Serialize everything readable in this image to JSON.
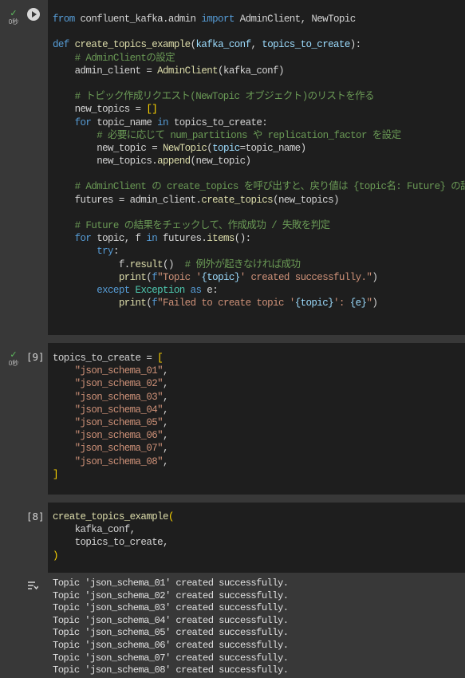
{
  "cells": [
    {
      "status_check": "✓",
      "status_time": "0秒",
      "exec_count": "",
      "lines": [
        "from confluent_kafka.admin import AdminClient, NewTopic",
        "",
        "def create_topics_example(kafka_conf, topics_to_create):",
        "    # AdminClientの設定",
        "    admin_client = AdminClient(kafka_conf)",
        "",
        "    # トピック作成リクエスト(NewTopic オブジェクト)のリストを作る",
        "    new_topics = []",
        "    for topic_name in topics_to_create:",
        "        # 必要に応じて num_partitions や replication_factor を設定",
        "        new_topic = NewTopic(topic=topic_name)",
        "        new_topics.append(new_topic)",
        "",
        "    # AdminClient の create_topics を呼び出すと、戻り値は {topic名: Future} の辞書",
        "    futures = admin_client.create_topics(new_topics)",
        "",
        "    # Future の結果をチェックして、作成成功 / 失敗を判定",
        "    for topic, f in futures.items():",
        "        try:",
        "            f.result()  # 例外が起きなければ成功",
        "            print(f\"Topic '{topic}' created successfully.\")",
        "        except Exception as e:",
        "            print(f\"Failed to create topic '{topic}': {e}\")"
      ]
    },
    {
      "status_check": "✓",
      "status_time": "0秒",
      "exec_count": "[9]",
      "lines": [
        "topics_to_create = [",
        "    \"json_schema_01\",",
        "    \"json_schema_02\",",
        "    \"json_schema_03\",",
        "    \"json_schema_04\",",
        "    \"json_schema_05\",",
        "    \"json_schema_06\",",
        "    \"json_schema_07\",",
        "    \"json_schema_08\",",
        "]"
      ]
    },
    {
      "exec_count": "[8]",
      "lines": [
        "create_topics_example(",
        "    kafka_conf,",
        "    topics_to_create,",
        ")"
      ]
    }
  ],
  "output": {
    "icon": "output-toggle-icon",
    "lines": [
      "Topic 'json_schema_01' created successfully.",
      "Topic 'json_schema_02' created successfully.",
      "Topic 'json_schema_03' created successfully.",
      "Topic 'json_schema_04' created successfully.",
      "Topic 'json_schema_05' created successfully.",
      "Topic 'json_schema_06' created successfully.",
      "Topic 'json_schema_07' created successfully.",
      "Topic 'json_schema_08' created successfully."
    ]
  }
}
